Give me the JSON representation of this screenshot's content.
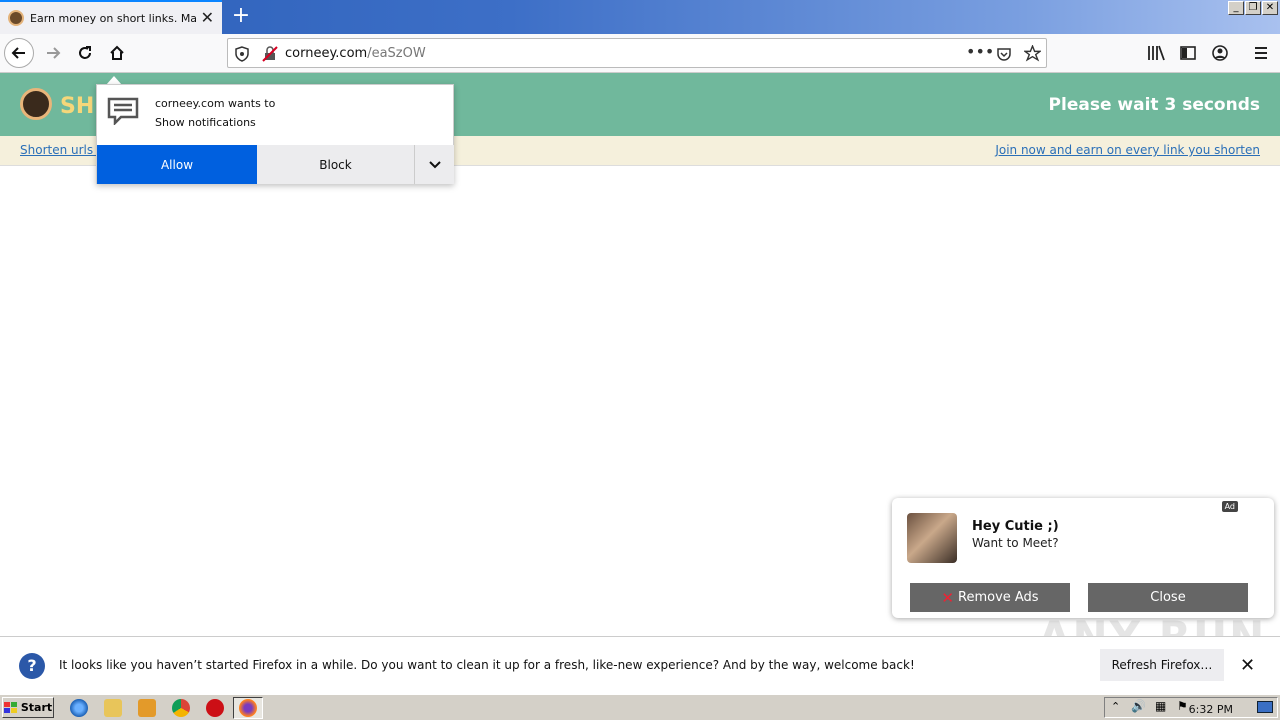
{
  "browser": {
    "tab_title": "Earn money on short links. Make sh",
    "url_domain": "corneey.com",
    "url_path": "/eaSzOW"
  },
  "site": {
    "logo_text": "SH",
    "wait_text": "Please wait 3 seconds",
    "shorten_link": "Shorten urls a",
    "join_link": "Join now and earn on every link you shorten"
  },
  "notification_prompt": {
    "line1": "corneey.com wants to",
    "line2": "Show notifications",
    "allow_label": "Allow",
    "block_label": "Block"
  },
  "ad": {
    "tag": "Ad",
    "title": "Hey Cutie ;)",
    "subtitle": "Want to Meet?",
    "remove_label": "Remove Ads",
    "close_label": "Close"
  },
  "firefox_notice": {
    "text": "It looks like you haven’t started Firefox in a while. Do you want to clean it up for a fresh, like-new experience? And by the way, welcome back!",
    "refresh_label": "Refresh Firefox…"
  },
  "watermark": "ANY RUN",
  "taskbar": {
    "start_label": "Start",
    "clock": "6:32 PM"
  }
}
